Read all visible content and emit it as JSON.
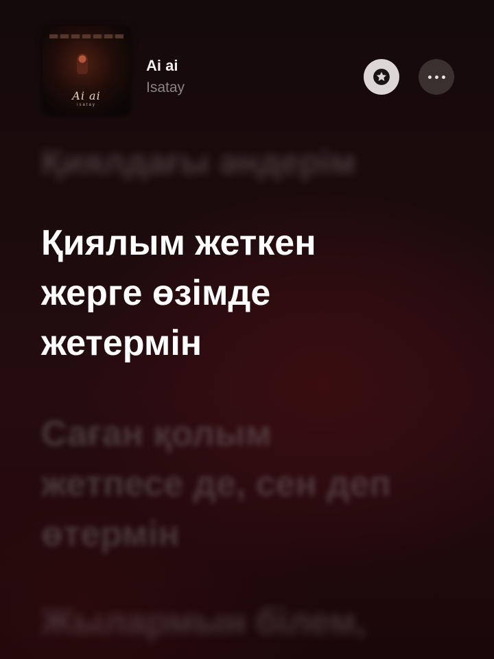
{
  "now_playing": {
    "title": "Ai ai",
    "artist": "Isatay",
    "artwork": {
      "script_text": "Ai ai",
      "small_text": "isatay"
    }
  },
  "buttons": {
    "favorite_icon": "star-icon",
    "more_icon": "ellipsis-icon"
  },
  "lyrics": {
    "previous": [
      "Қиялдағы әндерім"
    ],
    "current": [
      "Қиялым жеткен",
      "жерге өзімде",
      "жетермін"
    ],
    "next": [
      "Саған қолым",
      "жетпесе де, сен деп",
      "өтермін"
    ],
    "after": [
      "Жылармын білем,"
    ]
  },
  "colors": {
    "background": "#1c0b0d",
    "accent_glow": "#3a0d10",
    "current_lyric": "#ffffff",
    "artist": "#8c8585",
    "favorite_button": "#ddd6d6",
    "more_button": "#3a3030"
  }
}
